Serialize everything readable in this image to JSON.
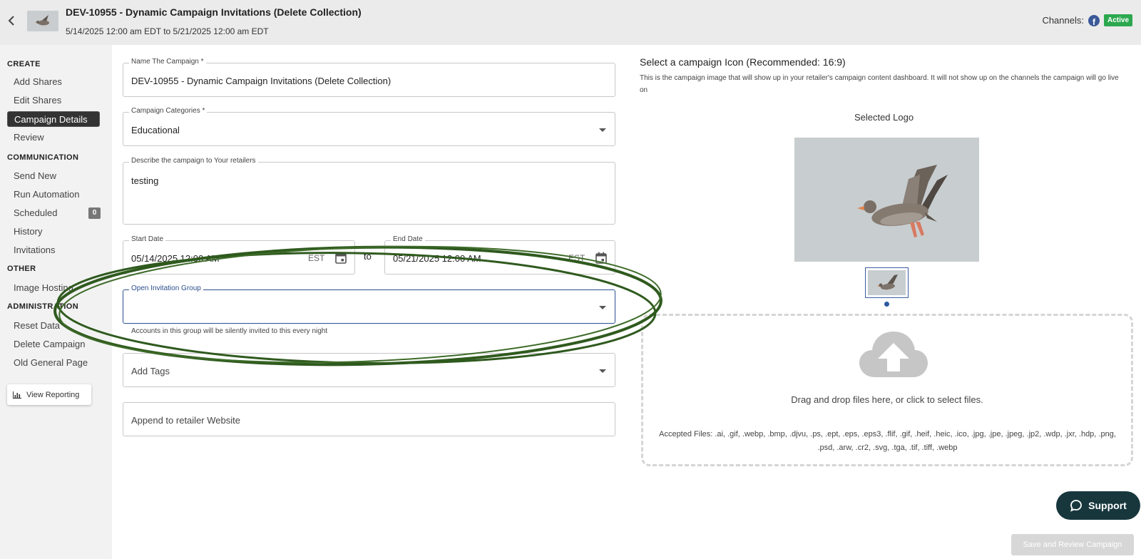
{
  "header": {
    "title": "DEV-10955 - Dynamic Campaign Invitations (Delete Collection)",
    "dates": "5/14/2025 12:00 am EDT to 5/21/2025 12:00 am EDT",
    "channels_label": "Channels:",
    "status_badge": "Active"
  },
  "sidebar": {
    "sections": [
      "CREATE",
      "COMMUNICATION",
      "OTHER",
      "ADMINISTRATION"
    ],
    "create_items": [
      "Add Shares",
      "Edit Shares",
      "Campaign Details",
      "Review"
    ],
    "communication_items": [
      "Send New",
      "Run Automation",
      "Scheduled",
      "History",
      "Invitations"
    ],
    "scheduled_count": "0",
    "other_items": [
      "Image Hosting"
    ],
    "admin_items": [
      "Reset Data",
      "Delete Campaign",
      "Old General Page"
    ],
    "selected_item": "Campaign Details",
    "view_reporting": "View Reporting"
  },
  "form": {
    "name": {
      "label": "Name The Campaign *",
      "value": "DEV-10955 - Dynamic Campaign Invitations (Delete Collection)"
    },
    "categories": {
      "label": "Campaign Categories *",
      "value": "Educational"
    },
    "description": {
      "label": "Describe the campaign to Your retailers",
      "value": "testing"
    },
    "start_date": {
      "label": "Start Date",
      "value": "05/14/2025 12:00 AM",
      "tz": "EST"
    },
    "to": "to",
    "end_date": {
      "label": "End Date",
      "value": "05/21/2025 12:00 AM",
      "tz": "EST"
    },
    "invitation_group": {
      "label": "Open Invitation Group",
      "value": "",
      "helper": "Accounts in this group will be silently invited to this every night"
    },
    "tags": {
      "placeholder": "Add Tags"
    },
    "append_website": {
      "placeholder": "Append to retailer Website"
    }
  },
  "icon_panel": {
    "title": "Select a campaign Icon (Recommended: 16:9)",
    "description": "This is the campaign image that will show up in your retailer's campaign content dashboard. It will not show up on the channels the campaign will go live on",
    "selected_logo_label": "Selected Logo",
    "drop_text": "Drag and drop files here, or click to select files.",
    "accepted_files": "Accepted Files: .ai, .gif, .webp, .bmp, .djvu, .ps, .ept, .eps, .eps3, .flif, .gif, .heif, .heic, .ico, .jpg, .jpe, .jpeg, .jp2, .wdp, .jxr, .hdp, .png, .psd, .arw, .cr2, .svg, .tga, .tif, .tiff, .webp"
  },
  "buttons": {
    "support": "Support",
    "save": "Save and Review Campaign"
  },
  "colors": {
    "header_bg": "#ebebeb",
    "sidebar_bg": "#f2f2f2",
    "selected_bg": "#333333",
    "active_green": "#2ca84f",
    "focus_blue": "#2b4f8f",
    "support_bg": "#17373d",
    "annotation_green": "#2f5a1e"
  }
}
